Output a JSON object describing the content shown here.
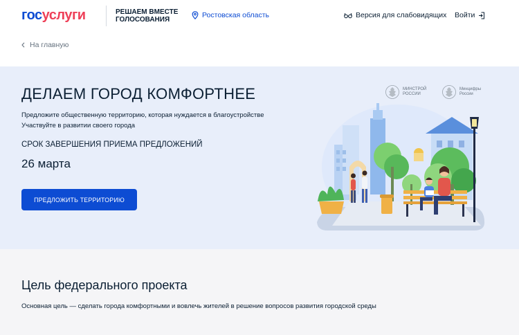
{
  "header": {
    "logo_part1": "гос",
    "logo_part2": "услуги",
    "tagline": "РЕШАЕМ ВМЕСТЕ\nГОЛОСОВАНИЯ",
    "region": "Ростовская область",
    "vision_link": "Версия для слабовидящих",
    "login": "Войти"
  },
  "breadcrumb": {
    "back_label": "На главную"
  },
  "hero": {
    "title": "ДЕЛАЕМ ГОРОД КОМФОРТНЕЕ",
    "desc_line1": "Предложите общественную территорию, которая нуждается в благоустройстве",
    "desc_line2": "Участвуйте в развитии своего города",
    "deadline_label": "СРОК ЗАВЕРШЕНИЯ ПРИЕМА ПРЕДЛОЖЕНИЙ",
    "deadline_date": "26 марта",
    "cta_label": "ПРЕДЛОЖИТЬ ТЕРРИТОРИЮ",
    "partners": [
      {
        "name": "МИНСТРОЙ\nРОССИИ",
        "icon": "emblem-icon"
      },
      {
        "name": "Минцифры\nРоссии",
        "icon": "emblem-icon"
      }
    ]
  },
  "goal": {
    "title": "Цель федерального проекта",
    "text": "Основная цель — сделать города комфортными и вовлечь жителей в решение вопросов развития городской среды"
  },
  "colors": {
    "brand_blue": "#0d4cd3",
    "brand_red": "#ee3f58",
    "hero_bg": "#e8eefa"
  }
}
